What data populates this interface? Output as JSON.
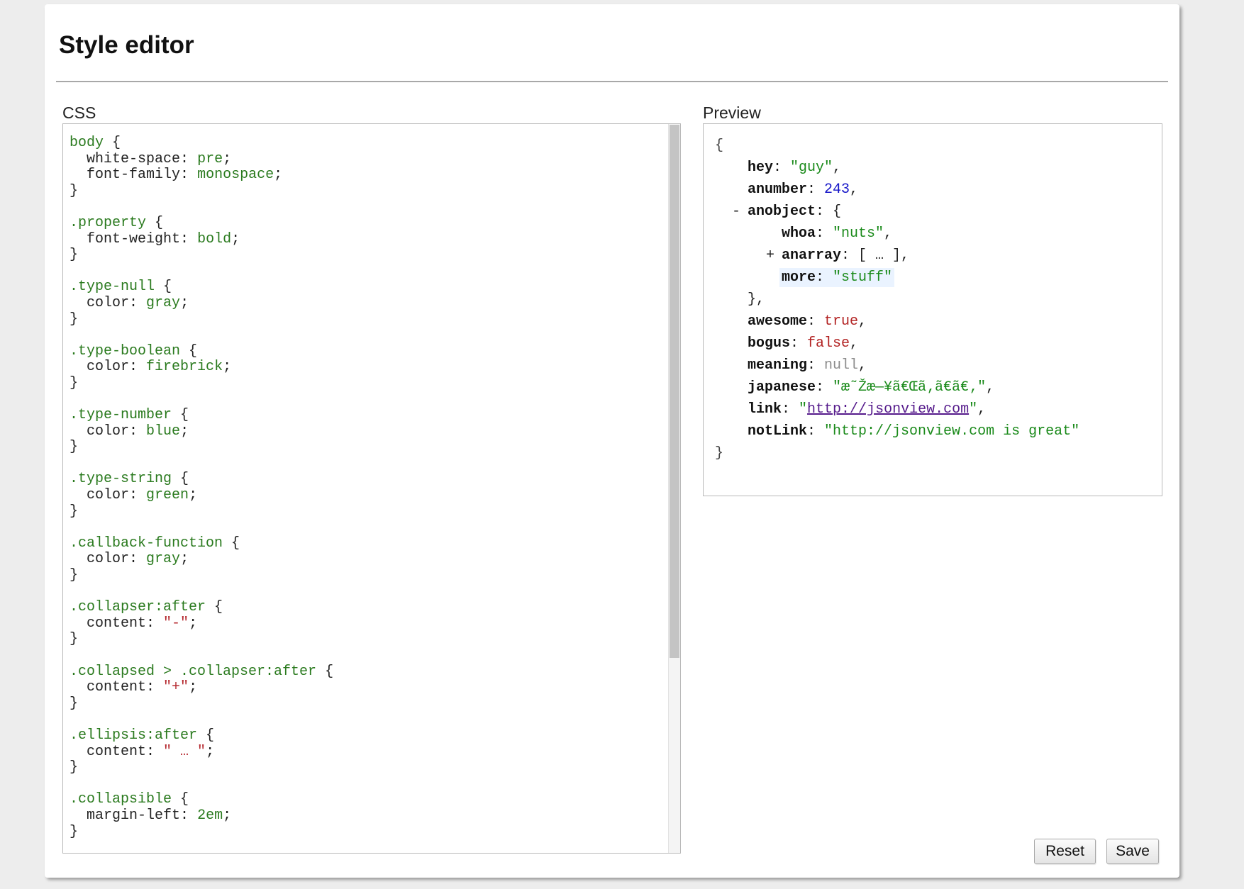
{
  "title": "Style editor",
  "css_label": "CSS",
  "preview_label": "Preview",
  "css_rules": [
    {
      "selector": "body",
      "decls": [
        {
          "prop": "white-space",
          "value": "pre",
          "kind": "val"
        },
        {
          "prop": "font-family",
          "value": "monospace",
          "kind": "val"
        }
      ]
    },
    {
      "selector": ".property",
      "decls": [
        {
          "prop": "font-weight",
          "value": "bold",
          "kind": "val"
        }
      ]
    },
    {
      "selector": ".type-null",
      "decls": [
        {
          "prop": "color",
          "value": "gray",
          "kind": "val"
        }
      ]
    },
    {
      "selector": ".type-boolean",
      "decls": [
        {
          "prop": "color",
          "value": "firebrick",
          "kind": "val"
        }
      ]
    },
    {
      "selector": ".type-number",
      "decls": [
        {
          "prop": "color",
          "value": "blue",
          "kind": "val"
        }
      ]
    },
    {
      "selector": ".type-string",
      "decls": [
        {
          "prop": "color",
          "value": "green",
          "kind": "val"
        }
      ]
    },
    {
      "selector": ".callback-function",
      "decls": [
        {
          "prop": "color",
          "value": "gray",
          "kind": "val"
        }
      ]
    },
    {
      "selector": ".collapser:after",
      "decls": [
        {
          "prop": "content",
          "value": "\"-\"",
          "kind": "str"
        }
      ]
    },
    {
      "selector": ".collapsed > .collapser:after",
      "decls": [
        {
          "prop": "content",
          "value": "\"+\"",
          "kind": "str"
        }
      ]
    },
    {
      "selector": ".ellipsis:after",
      "decls": [
        {
          "prop": "content",
          "value": "\" … \"",
          "kind": "str"
        }
      ]
    },
    {
      "selector": ".collapsible",
      "decls": [
        {
          "prop": "margin-left",
          "value": "2em",
          "kind": "val"
        }
      ]
    }
  ],
  "preview": {
    "open_brace": "{",
    "close_brace": "}",
    "hey": {
      "key": "hey",
      "value": "\"guy\""
    },
    "anumber": {
      "key": "anumber",
      "value": "243"
    },
    "anobject": {
      "collapser": "-",
      "key": "anobject",
      "open": "{",
      "close": "},",
      "whoa": {
        "key": "whoa",
        "value": "\"nuts\""
      },
      "anarray": {
        "collapser": "+",
        "key": "anarray",
        "value": "[ … ]"
      },
      "more": {
        "key": "more",
        "value": "\"stuff\""
      }
    },
    "awesome": {
      "key": "awesome",
      "value": "true"
    },
    "bogus": {
      "key": "bogus",
      "value": "false"
    },
    "meaning": {
      "key": "meaning",
      "value": "null"
    },
    "japanese": {
      "key": "japanese",
      "value": "\"æ˜Žæ—¥ã€Œã‚ã€ã€‚\""
    },
    "link": {
      "key": "link",
      "value": "http://jsonview.com"
    },
    "notLink": {
      "key": "notLink",
      "value": "\"http://jsonview.com is great\""
    }
  },
  "buttons": {
    "reset": "Reset",
    "save": "Save"
  },
  "colors": {
    "string": "#1a8a1a",
    "number": "#1717c8",
    "boolean": "#b22222",
    "null": "#8c8c8c",
    "link": "#551a8b"
  }
}
